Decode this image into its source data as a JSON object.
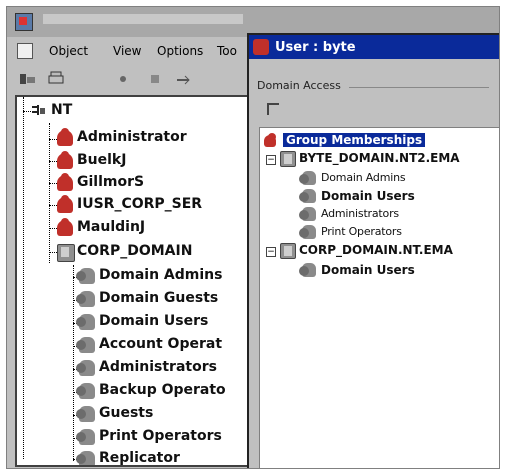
{
  "back_window": {
    "menu": [
      "Object",
      "View",
      "Options",
      "Too"
    ]
  },
  "tree": {
    "root": "NT",
    "items": [
      {
        "label": "Administrator",
        "kind": "user"
      },
      {
        "label": "BuelkJ",
        "kind": "user"
      },
      {
        "label": "GillmorS",
        "kind": "user"
      },
      {
        "label": "IUSR_CORP_SER",
        "kind": "user"
      },
      {
        "label": "MauldinJ",
        "kind": "user"
      },
      {
        "label": "CORP_DOMAIN",
        "kind": "domain"
      }
    ],
    "domain_children": [
      "Domain Admins",
      "Domain Guests",
      "Domain Users",
      "Account Operat",
      "Administrators",
      "Backup Operato",
      "Guests",
      "Print Operators",
      "Replicator"
    ]
  },
  "dialog": {
    "title": "User : byte",
    "tab_label": "Domain Access",
    "group_header": "Group Memberships",
    "domains": [
      {
        "name": "BYTE_DOMAIN.NT2.EMA",
        "groups": [
          "Domain Admins",
          "Domain Users",
          "Administrators",
          "Print Operators"
        ]
      },
      {
        "name": "CORP_DOMAIN.NT.EMA",
        "groups": [
          "Domain Users"
        ]
      }
    ]
  },
  "colors": {
    "titlebar_active": "#0a2a9a",
    "user_icon": "#c0302a",
    "window_face": "#c0c0c0"
  }
}
